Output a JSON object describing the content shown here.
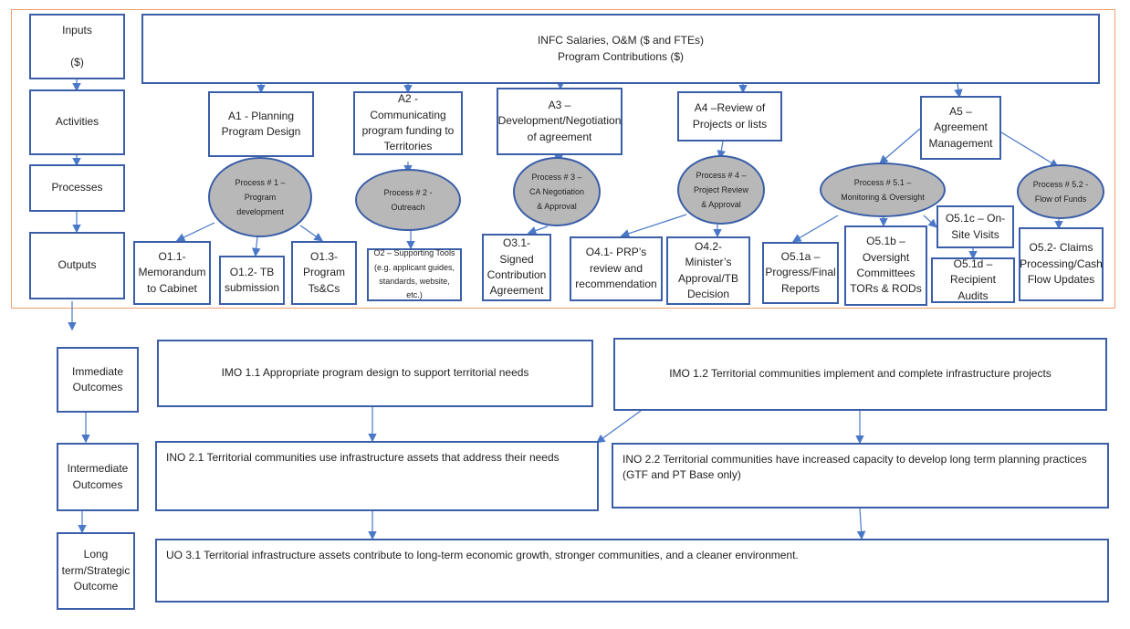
{
  "rows": {
    "inputs": "Inputs\n\n($)",
    "activities": "Activities",
    "processes": "Processes",
    "outputs": "Outputs",
    "immediate": "Immediate\nOutcomes",
    "intermediate": "Intermediate\nOutcomes",
    "longterm": "Long\nterm/Strategic\nOutcome"
  },
  "inputs_banner": "INFC Salaries, O&M ($ and FTEs)\nProgram Contributions ($)",
  "activities": {
    "a1": "A1 -  Planning\nProgram Design",
    "a2": "A2 - Communicating\nprogram funding to\nTerritories",
    "a3": "A3 –\nDevelopment/Negotiation\nof agreement",
    "a4": "A4 –Review of\nProjects or lists",
    "a5": "A5 –\nAgreement\nManagement"
  },
  "processes": {
    "p1": "Process # 1 –\nProgram\ndevelopment",
    "p2": "Process # 2 -\nOutreach",
    "p3": "Process # 3 –\nCA Negotiation\n& Approval",
    "p4": "Process # 4 –\nProject Review\n& Approval",
    "p51": "Process # 5.1 –\nMonitoring & Oversight",
    "p52": "Process # 5.2 -\nFlow of Funds"
  },
  "outputs": {
    "o11": "O1.1-\nMemorandum\nto Cabinet",
    "o12": "O1.2- TB\nsubmission",
    "o13": "O1.3-\nProgram\nTs&Cs",
    "o2": "O2 – Supporting Tools\n(e.g. applicant guides,\nstandards, website, etc.)",
    "o31": "O3.1- Signed\nContribution\nAgreement",
    "o41": "O4.1- PRP’s\nreview and\nrecommendation",
    "o42": "O4.2- Minister’s\nApproval/TB\nDecision",
    "o51a": "O5.1a –\nProgress/Final\nReports",
    "o51b": "O5.1b –\nOversight\nCommittees\nTORs & RODs",
    "o51c": "O5.1c – On-\nSite Visits",
    "o51d": "O5.1d –\nRecipient Audits",
    "o52": "O5.2- Claims\nProcessing/Cash\nFlow Updates"
  },
  "outcomes": {
    "imo11": "IMO 1.1 Appropriate program design to support territorial needs",
    "imo12": "IMO 1.2 Territorial communities implement and complete infrastructure projects",
    "ino21": "INO 2.1 Territorial communities use infrastructure assets that address their needs",
    "ino22": "INO 2.2 Territorial communities have increased capacity to develop long term planning practices (GTF and PT Base only)",
    "uo31": "UO 3.1 Territorial infrastructure assets contribute to long-term economic growth, stronger communities, and a cleaner environment."
  },
  "colors": {
    "border": "#3a5ea8",
    "process_fill": "#b8b8b8",
    "frame": "#f0a070",
    "arrow": "#4a78c8"
  }
}
